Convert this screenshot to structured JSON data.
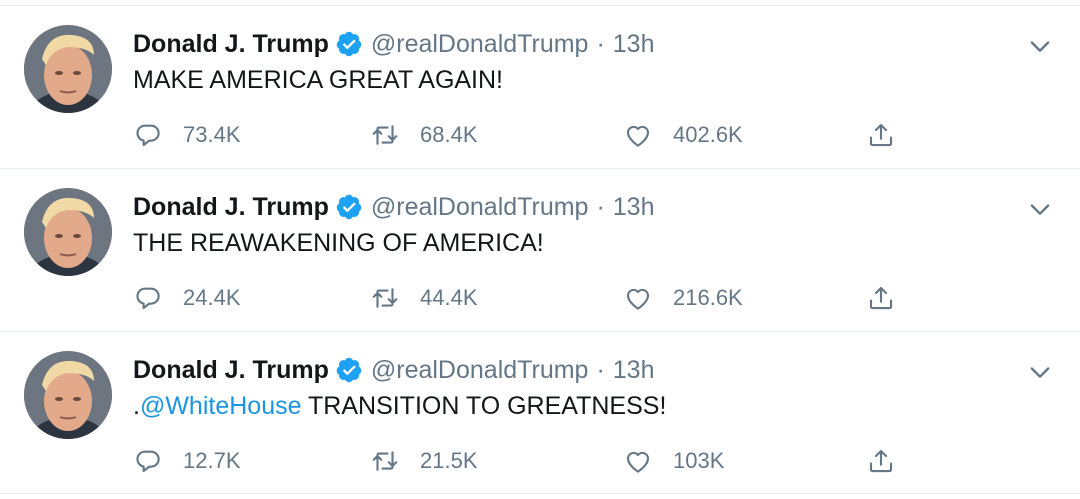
{
  "tweets": [
    {
      "name": "Donald J. Trump",
      "handle": "@realDonaldTrump",
      "separator": "·",
      "time": "13h",
      "text_prefix": "",
      "mention": "",
      "text": "MAKE AMERICA GREAT AGAIN!",
      "replies": "73.4K",
      "retweets": "68.4K",
      "likes": "402.6K"
    },
    {
      "name": "Donald J. Trump",
      "handle": "@realDonaldTrump",
      "separator": "·",
      "time": "13h",
      "text_prefix": "",
      "mention": "",
      "text": "THE REAWAKENING OF AMERICA!",
      "replies": "24.4K",
      "retweets": "44.4K",
      "likes": "216.6K"
    },
    {
      "name": "Donald J. Trump",
      "handle": "@realDonaldTrump",
      "separator": "·",
      "time": "13h",
      "text_prefix": ".",
      "mention": "@WhiteHouse",
      "text": " TRANSITION TO GREATNESS!",
      "replies": "12.7K",
      "retweets": "21.5K",
      "likes": "103K"
    }
  ],
  "colors": {
    "text": "#14171a",
    "secondary": "#657786",
    "link": "#1b95e0",
    "verified": "#1da1f2",
    "divider": "#e6ecf0"
  },
  "icons": {
    "verified": "verified-badge-icon",
    "caret": "chevron-down-icon",
    "reply": "reply-icon",
    "retweet": "retweet-icon",
    "like": "heart-icon",
    "share": "share-icon"
  }
}
